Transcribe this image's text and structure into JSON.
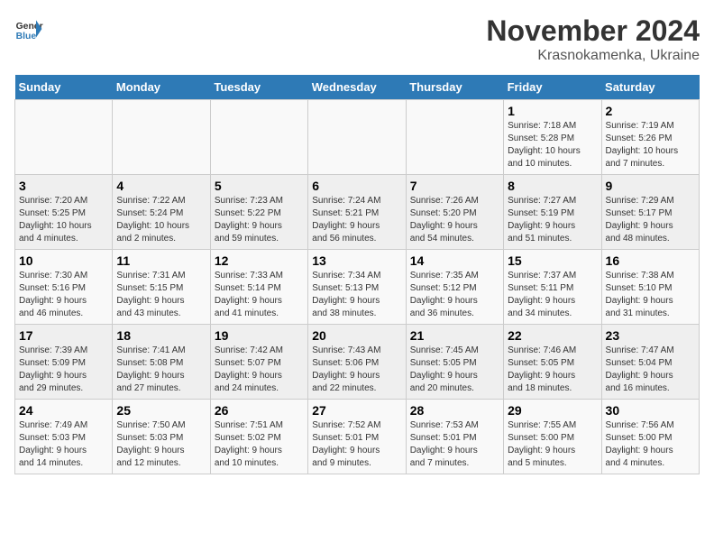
{
  "logo": {
    "line1": "General",
    "line2": "Blue"
  },
  "title": "November 2024",
  "subtitle": "Krasnokamenka, Ukraine",
  "weekdays": [
    "Sunday",
    "Monday",
    "Tuesday",
    "Wednesday",
    "Thursday",
    "Friday",
    "Saturday"
  ],
  "weeks": [
    [
      {
        "day": "",
        "info": ""
      },
      {
        "day": "",
        "info": ""
      },
      {
        "day": "",
        "info": ""
      },
      {
        "day": "",
        "info": ""
      },
      {
        "day": "",
        "info": ""
      },
      {
        "day": "1",
        "info": "Sunrise: 7:18 AM\nSunset: 5:28 PM\nDaylight: 10 hours\nand 10 minutes."
      },
      {
        "day": "2",
        "info": "Sunrise: 7:19 AM\nSunset: 5:26 PM\nDaylight: 10 hours\nand 7 minutes."
      }
    ],
    [
      {
        "day": "3",
        "info": "Sunrise: 7:20 AM\nSunset: 5:25 PM\nDaylight: 10 hours\nand 4 minutes."
      },
      {
        "day": "4",
        "info": "Sunrise: 7:22 AM\nSunset: 5:24 PM\nDaylight: 10 hours\nand 2 minutes."
      },
      {
        "day": "5",
        "info": "Sunrise: 7:23 AM\nSunset: 5:22 PM\nDaylight: 9 hours\nand 59 minutes."
      },
      {
        "day": "6",
        "info": "Sunrise: 7:24 AM\nSunset: 5:21 PM\nDaylight: 9 hours\nand 56 minutes."
      },
      {
        "day": "7",
        "info": "Sunrise: 7:26 AM\nSunset: 5:20 PM\nDaylight: 9 hours\nand 54 minutes."
      },
      {
        "day": "8",
        "info": "Sunrise: 7:27 AM\nSunset: 5:19 PM\nDaylight: 9 hours\nand 51 minutes."
      },
      {
        "day": "9",
        "info": "Sunrise: 7:29 AM\nSunset: 5:17 PM\nDaylight: 9 hours\nand 48 minutes."
      }
    ],
    [
      {
        "day": "10",
        "info": "Sunrise: 7:30 AM\nSunset: 5:16 PM\nDaylight: 9 hours\nand 46 minutes."
      },
      {
        "day": "11",
        "info": "Sunrise: 7:31 AM\nSunset: 5:15 PM\nDaylight: 9 hours\nand 43 minutes."
      },
      {
        "day": "12",
        "info": "Sunrise: 7:33 AM\nSunset: 5:14 PM\nDaylight: 9 hours\nand 41 minutes."
      },
      {
        "day": "13",
        "info": "Sunrise: 7:34 AM\nSunset: 5:13 PM\nDaylight: 9 hours\nand 38 minutes."
      },
      {
        "day": "14",
        "info": "Sunrise: 7:35 AM\nSunset: 5:12 PM\nDaylight: 9 hours\nand 36 minutes."
      },
      {
        "day": "15",
        "info": "Sunrise: 7:37 AM\nSunset: 5:11 PM\nDaylight: 9 hours\nand 34 minutes."
      },
      {
        "day": "16",
        "info": "Sunrise: 7:38 AM\nSunset: 5:10 PM\nDaylight: 9 hours\nand 31 minutes."
      }
    ],
    [
      {
        "day": "17",
        "info": "Sunrise: 7:39 AM\nSunset: 5:09 PM\nDaylight: 9 hours\nand 29 minutes."
      },
      {
        "day": "18",
        "info": "Sunrise: 7:41 AM\nSunset: 5:08 PM\nDaylight: 9 hours\nand 27 minutes."
      },
      {
        "day": "19",
        "info": "Sunrise: 7:42 AM\nSunset: 5:07 PM\nDaylight: 9 hours\nand 24 minutes."
      },
      {
        "day": "20",
        "info": "Sunrise: 7:43 AM\nSunset: 5:06 PM\nDaylight: 9 hours\nand 22 minutes."
      },
      {
        "day": "21",
        "info": "Sunrise: 7:45 AM\nSunset: 5:05 PM\nDaylight: 9 hours\nand 20 minutes."
      },
      {
        "day": "22",
        "info": "Sunrise: 7:46 AM\nSunset: 5:05 PM\nDaylight: 9 hours\nand 18 minutes."
      },
      {
        "day": "23",
        "info": "Sunrise: 7:47 AM\nSunset: 5:04 PM\nDaylight: 9 hours\nand 16 minutes."
      }
    ],
    [
      {
        "day": "24",
        "info": "Sunrise: 7:49 AM\nSunset: 5:03 PM\nDaylight: 9 hours\nand 14 minutes."
      },
      {
        "day": "25",
        "info": "Sunrise: 7:50 AM\nSunset: 5:03 PM\nDaylight: 9 hours\nand 12 minutes."
      },
      {
        "day": "26",
        "info": "Sunrise: 7:51 AM\nSunset: 5:02 PM\nDaylight: 9 hours\nand 10 minutes."
      },
      {
        "day": "27",
        "info": "Sunrise: 7:52 AM\nSunset: 5:01 PM\nDaylight: 9 hours\nand 9 minutes."
      },
      {
        "day": "28",
        "info": "Sunrise: 7:53 AM\nSunset: 5:01 PM\nDaylight: 9 hours\nand 7 minutes."
      },
      {
        "day": "29",
        "info": "Sunrise: 7:55 AM\nSunset: 5:00 PM\nDaylight: 9 hours\nand 5 minutes."
      },
      {
        "day": "30",
        "info": "Sunrise: 7:56 AM\nSunset: 5:00 PM\nDaylight: 9 hours\nand 4 minutes."
      }
    ]
  ]
}
